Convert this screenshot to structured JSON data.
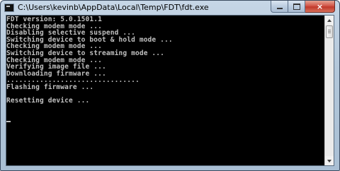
{
  "window": {
    "title": "C:\\Users\\kevinb\\AppData\\Local\\Temp\\FDT\\fdt.exe",
    "icon": "console-icon",
    "buttons": {
      "minimize": "minimize-icon",
      "maximize": "maximize-icon",
      "close": "×"
    }
  },
  "console": {
    "lines": [
      "FDT version: 5.0.1501.1",
      "Checking modem mode ...",
      "Disabling selective suspend ...",
      "Switching device to boot & hold mode ...",
      "Checking modem mode ...",
      "Switching device to streaming mode ...",
      "Checking modem mode ...",
      "Verifying image file ...",
      "Downloading firmware ...",
      "................................",
      "Flashing firmware ...",
      "",
      "Resetting device ..."
    ],
    "text_color": "#c0c0c0",
    "background": "#000000"
  }
}
